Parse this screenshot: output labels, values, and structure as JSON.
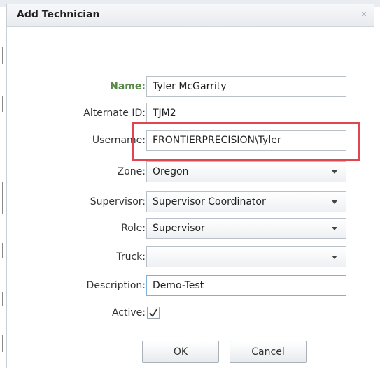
{
  "dialog": {
    "title": "Add Technician",
    "close_icon": "close-icon"
  },
  "form": {
    "name": {
      "label": "Name:",
      "value": "Tyler McGarrity"
    },
    "alternate_id": {
      "label": "Alternate ID:",
      "value": "TJM2"
    },
    "username": {
      "label": "Username:",
      "value": "FRONTIERPRECISION\\Tyler"
    },
    "zone": {
      "label": "Zone:",
      "value": "Oregon"
    },
    "supervisor": {
      "label": "Supervisor:",
      "value": "Supervisor Coordinator"
    },
    "role": {
      "label": "Role:",
      "value": "Supervisor"
    },
    "truck": {
      "label": "Truck:",
      "value": ""
    },
    "description": {
      "label": "Description:",
      "value": "Demo-Test"
    },
    "active": {
      "label": "Active:",
      "checked": true
    }
  },
  "buttons": {
    "ok": "OK",
    "cancel": "Cancel"
  },
  "colors": {
    "name_label_accent": "#5a8a4a",
    "highlight_box": "#e0464f",
    "focus_border": "#7fb0dc"
  }
}
